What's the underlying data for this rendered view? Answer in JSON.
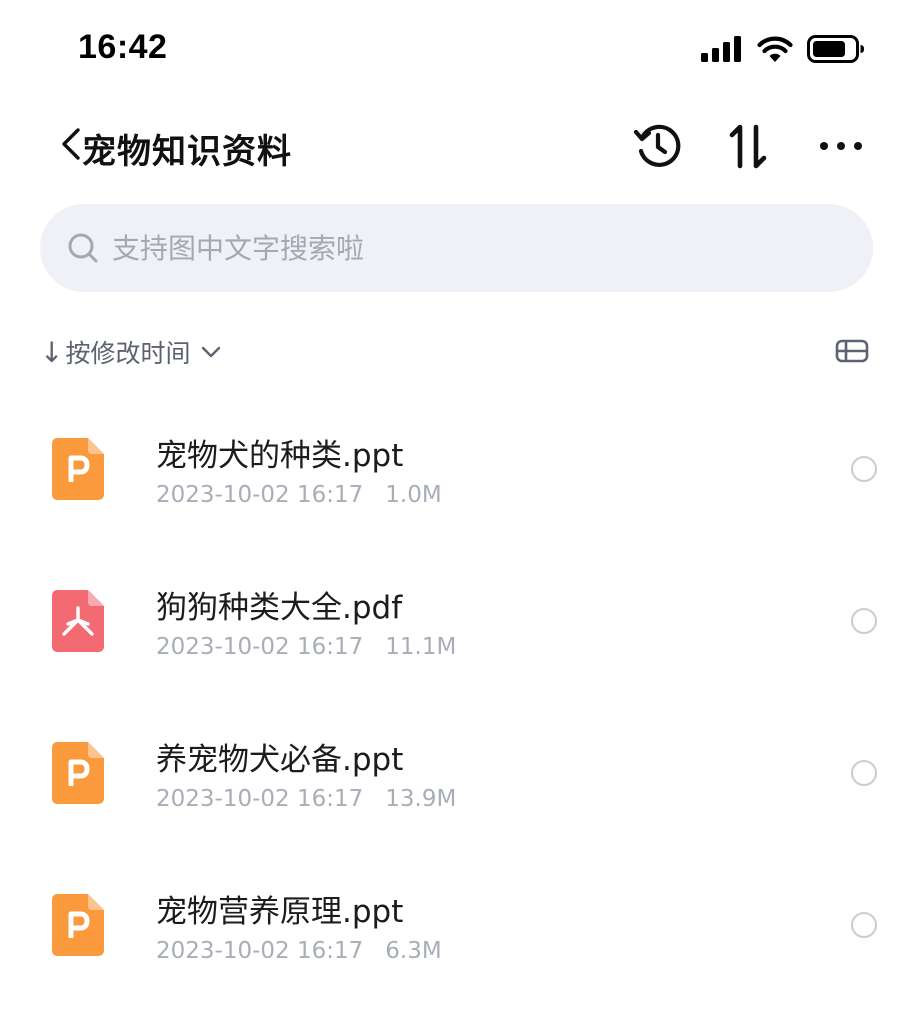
{
  "status_bar": {
    "time": "16:42"
  },
  "header": {
    "title": "宠物知识资料"
  },
  "search": {
    "placeholder": "支持图中文字搜索啦"
  },
  "sort": {
    "arrow": "↓",
    "label": "按修改时间"
  },
  "files": [
    {
      "name": "宠物犬的种类.ppt",
      "date": "2023-10-02 16:17",
      "size": "1.0M",
      "type": "ppt"
    },
    {
      "name": "狗狗种类大全.pdf",
      "date": "2023-10-02 16:17",
      "size": "11.1M",
      "type": "pdf"
    },
    {
      "name": "养宠物犬必备.ppt",
      "date": "2023-10-02 16:17",
      "size": "13.9M",
      "type": "ppt"
    },
    {
      "name": "宠物营养原理.ppt",
      "date": "2023-10-02 16:17",
      "size": "6.3M",
      "type": "ppt"
    }
  ],
  "icons": {
    "back": "back-arrow-icon",
    "history": "history-icon",
    "sort": "sort-icon",
    "more": "more-icon",
    "search": "search-icon",
    "view": "view-toggle-icon",
    "ppt": "ppt-file-icon",
    "pdf": "pdf-file-icon"
  },
  "colors": {
    "ppt": "#fb9a3c",
    "pdf": "#f36a73",
    "search_bg": "#eff1f6",
    "meta_text": "#a8adb7"
  }
}
